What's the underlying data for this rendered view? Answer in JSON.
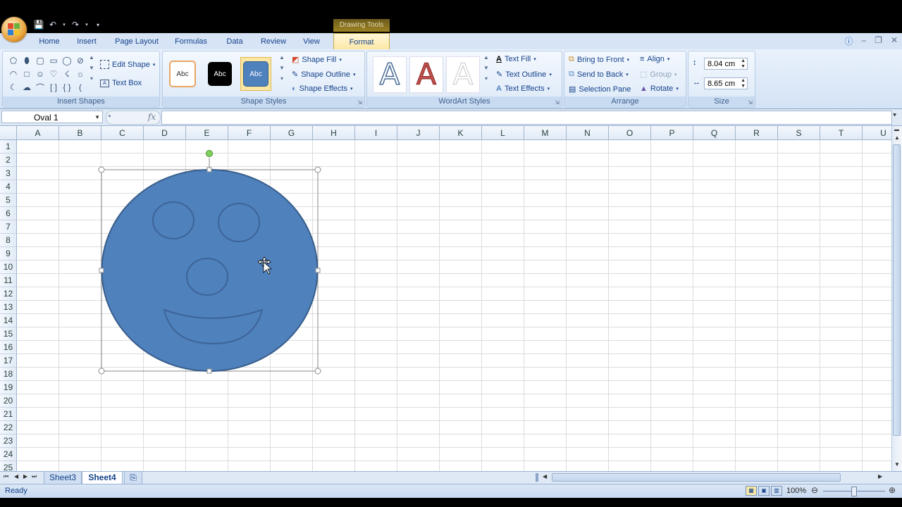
{
  "context_tab": "Drawing Tools",
  "tabs": [
    "Home",
    "Insert",
    "Page Layout",
    "Formulas",
    "Data",
    "Review",
    "View",
    "Format"
  ],
  "active_tab": "Format",
  "ribbon": {
    "insert_shapes": {
      "label": "Insert Shapes",
      "edit_shape": "Edit Shape",
      "text_box": "Text Box"
    },
    "shape_styles": {
      "label": "Shape Styles",
      "swatch_text": "Abc",
      "shape_fill": "Shape Fill",
      "shape_outline": "Shape Outline",
      "shape_effects": "Shape Effects"
    },
    "wordart": {
      "label": "WordArt Styles",
      "letter": "A",
      "text_fill": "Text Fill",
      "text_outline": "Text Outline",
      "text_effects": "Text Effects"
    },
    "arrange": {
      "label": "Arrange",
      "bring_front": "Bring to Front",
      "send_back": "Send to Back",
      "selection_pane": "Selection Pane",
      "align": "Align",
      "group": "Group",
      "rotate": "Rotate"
    },
    "size": {
      "label": "Size",
      "height": "8.04 cm",
      "width": "8.65 cm"
    }
  },
  "formula_bar": {
    "name_box": "Oval 1",
    "fx": "fx",
    "value": ""
  },
  "columns": [
    "A",
    "B",
    "C",
    "D",
    "E",
    "F",
    "G",
    "H",
    "I",
    "J",
    "K",
    "L",
    "M",
    "N",
    "O",
    "P",
    "Q",
    "R",
    "S",
    "T",
    "U"
  ],
  "rows": [
    "1",
    "2",
    "3",
    "4",
    "5",
    "6",
    "7",
    "8",
    "9",
    "10",
    "11",
    "12",
    "13",
    "14",
    "15",
    "16",
    "17",
    "18",
    "19",
    "20",
    "21",
    "22",
    "23",
    "24",
    "25"
  ],
  "sheets": [
    "Sheet3",
    "Sheet4"
  ],
  "active_sheet": "Sheet4",
  "status": {
    "ready": "Ready",
    "zoom": "100%"
  },
  "colors": {
    "shape_fill": "#4f81bd",
    "shape_line": "#385d8a",
    "accent": "#15428b"
  }
}
